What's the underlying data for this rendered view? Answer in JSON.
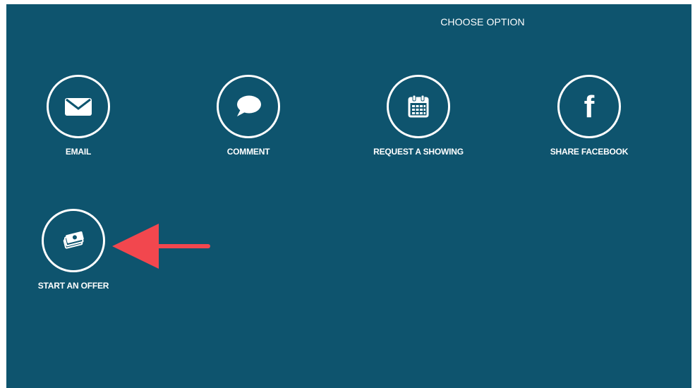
{
  "dialog": {
    "title": "CHOOSE OPTION"
  },
  "options": [
    {
      "label": "EMAIL",
      "icon": "envelope-icon"
    },
    {
      "label": "COMMENT",
      "icon": "speech-bubble-icon"
    },
    {
      "label": "REQUEST A SHOWING",
      "icon": "calendar-icon"
    },
    {
      "label": "SHARE FACEBOOK",
      "icon": "facebook-icon",
      "glyph": "f"
    },
    {
      "label": "START AN OFFER",
      "icon": "money-icon"
    }
  ],
  "annotation": {
    "icon": "arrow-pointer-icon",
    "color": "#f2474e"
  },
  "colors": {
    "background": "#0e546e",
    "foreground": "#ffffff"
  }
}
